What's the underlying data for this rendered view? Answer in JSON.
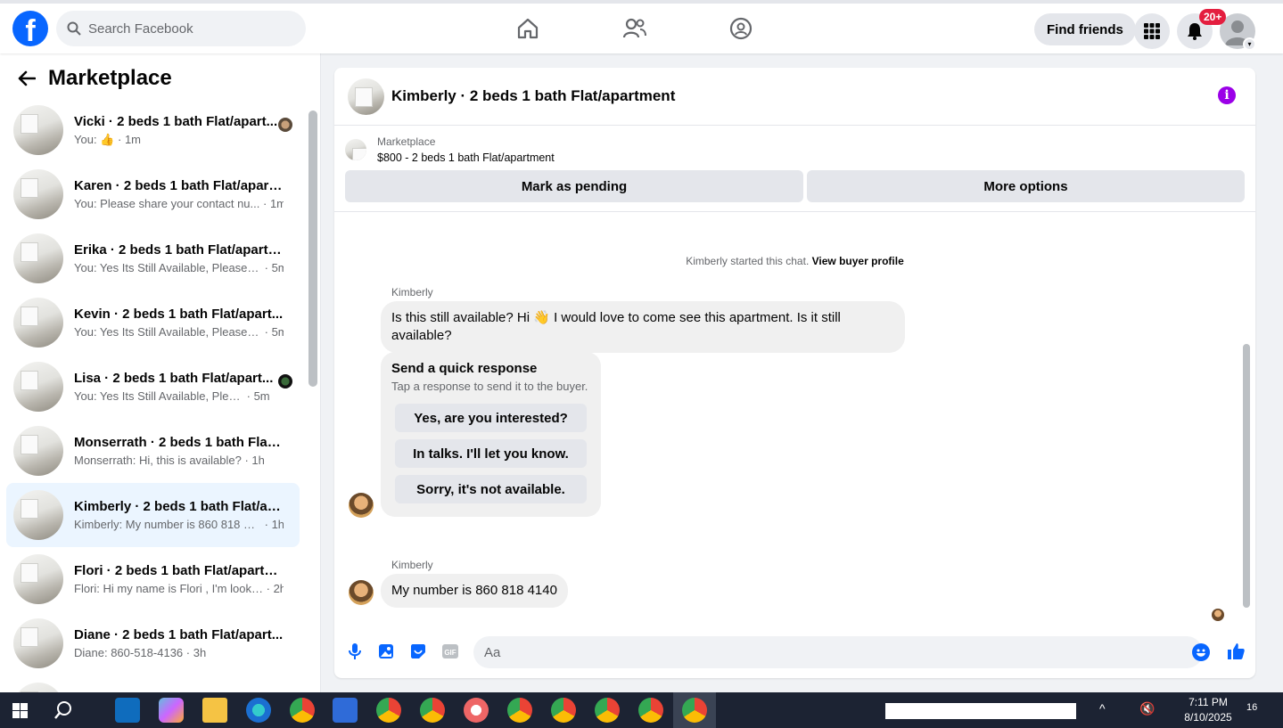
{
  "topbar": {
    "search_placeholder": "Search Facebook",
    "find_friends_label": "Find friends",
    "notification_badge": "20+"
  },
  "left": {
    "title": "Marketplace",
    "conversations": [
      {
        "title": "Vicki · 2 beds 1 bath Flat/apart...",
        "snippet": "You:",
        "time": "· 1m",
        "has_like": true
      },
      {
        "title": "Karen · 2 beds 1 bath Flat/apart...",
        "snippet": "You: Please share your contact nu...",
        "time": "· 1m"
      },
      {
        "title": "Erika · 2 beds 1 bath Flat/apartm...",
        "snippet": "You: Yes Its Still Available, Please S...",
        "time": "· 5m"
      },
      {
        "title": "Kevin · 2 beds 1 bath Flat/apart...",
        "snippet": "You: Yes Its Still Available, Please S...",
        "time": "· 5m"
      },
      {
        "title": "Lisa · 2 beds 1 bath Flat/apart...",
        "snippet": "You: Yes Its Still Available, Pleas...",
        "time": "· 5m"
      },
      {
        "title": "Monserrath · 2 beds 1 bath Flat/...",
        "snippet": "Monserrath: Hi, this is available?",
        "time": "· 1h"
      },
      {
        "title": "Kimberly · 2 beds 1 bath Flat/ap...",
        "snippet": "Kimberly: My number is 860 818 41...",
        "time": "· 1h"
      },
      {
        "title": "Flori · 2 beds 1 bath Flat/apartm...",
        "snippet": "Flori: Hi my name is Flori , I'm looki...",
        "time": "· 2h"
      },
      {
        "title": "Diane · 2 beds 1 bath Flat/apart...",
        "snippet": "Diane: 860-518-4136",
        "time": "· 3h"
      }
    ]
  },
  "chat": {
    "title": "Kimberly · 2 beds 1 bath Flat/apartment",
    "listing_source": "Marketplace",
    "listing_price_title": "$800 - 2 beds 1 bath Flat/apartment",
    "mark_pending_label": "Mark as pending",
    "more_options_label": "More options",
    "started_text": "Kimberly started this chat.",
    "view_profile_label": "View buyer profile",
    "sender_name": "Kimberly",
    "message1": "Is this still available? Hi 👋 I would love to come see this apartment.  Is it still available?",
    "quick_title": "Send a quick response",
    "quick_sub": "Tap a response to send it to the buyer.",
    "quick_options": [
      "Yes, are you interested?",
      "In talks. I'll let you know.",
      "Sorry, it's not available."
    ],
    "message2": "My number is 860 818 4140",
    "composer_placeholder": "Aa"
  },
  "taskbar": {
    "time": "7:11 PM",
    "date": "8/10/2025",
    "notification_count": "16"
  },
  "colors": {
    "brand": "#0866ff",
    "badge": "#e41e3f",
    "info": "#9b00e8",
    "active_row": "#ebf5ff"
  }
}
